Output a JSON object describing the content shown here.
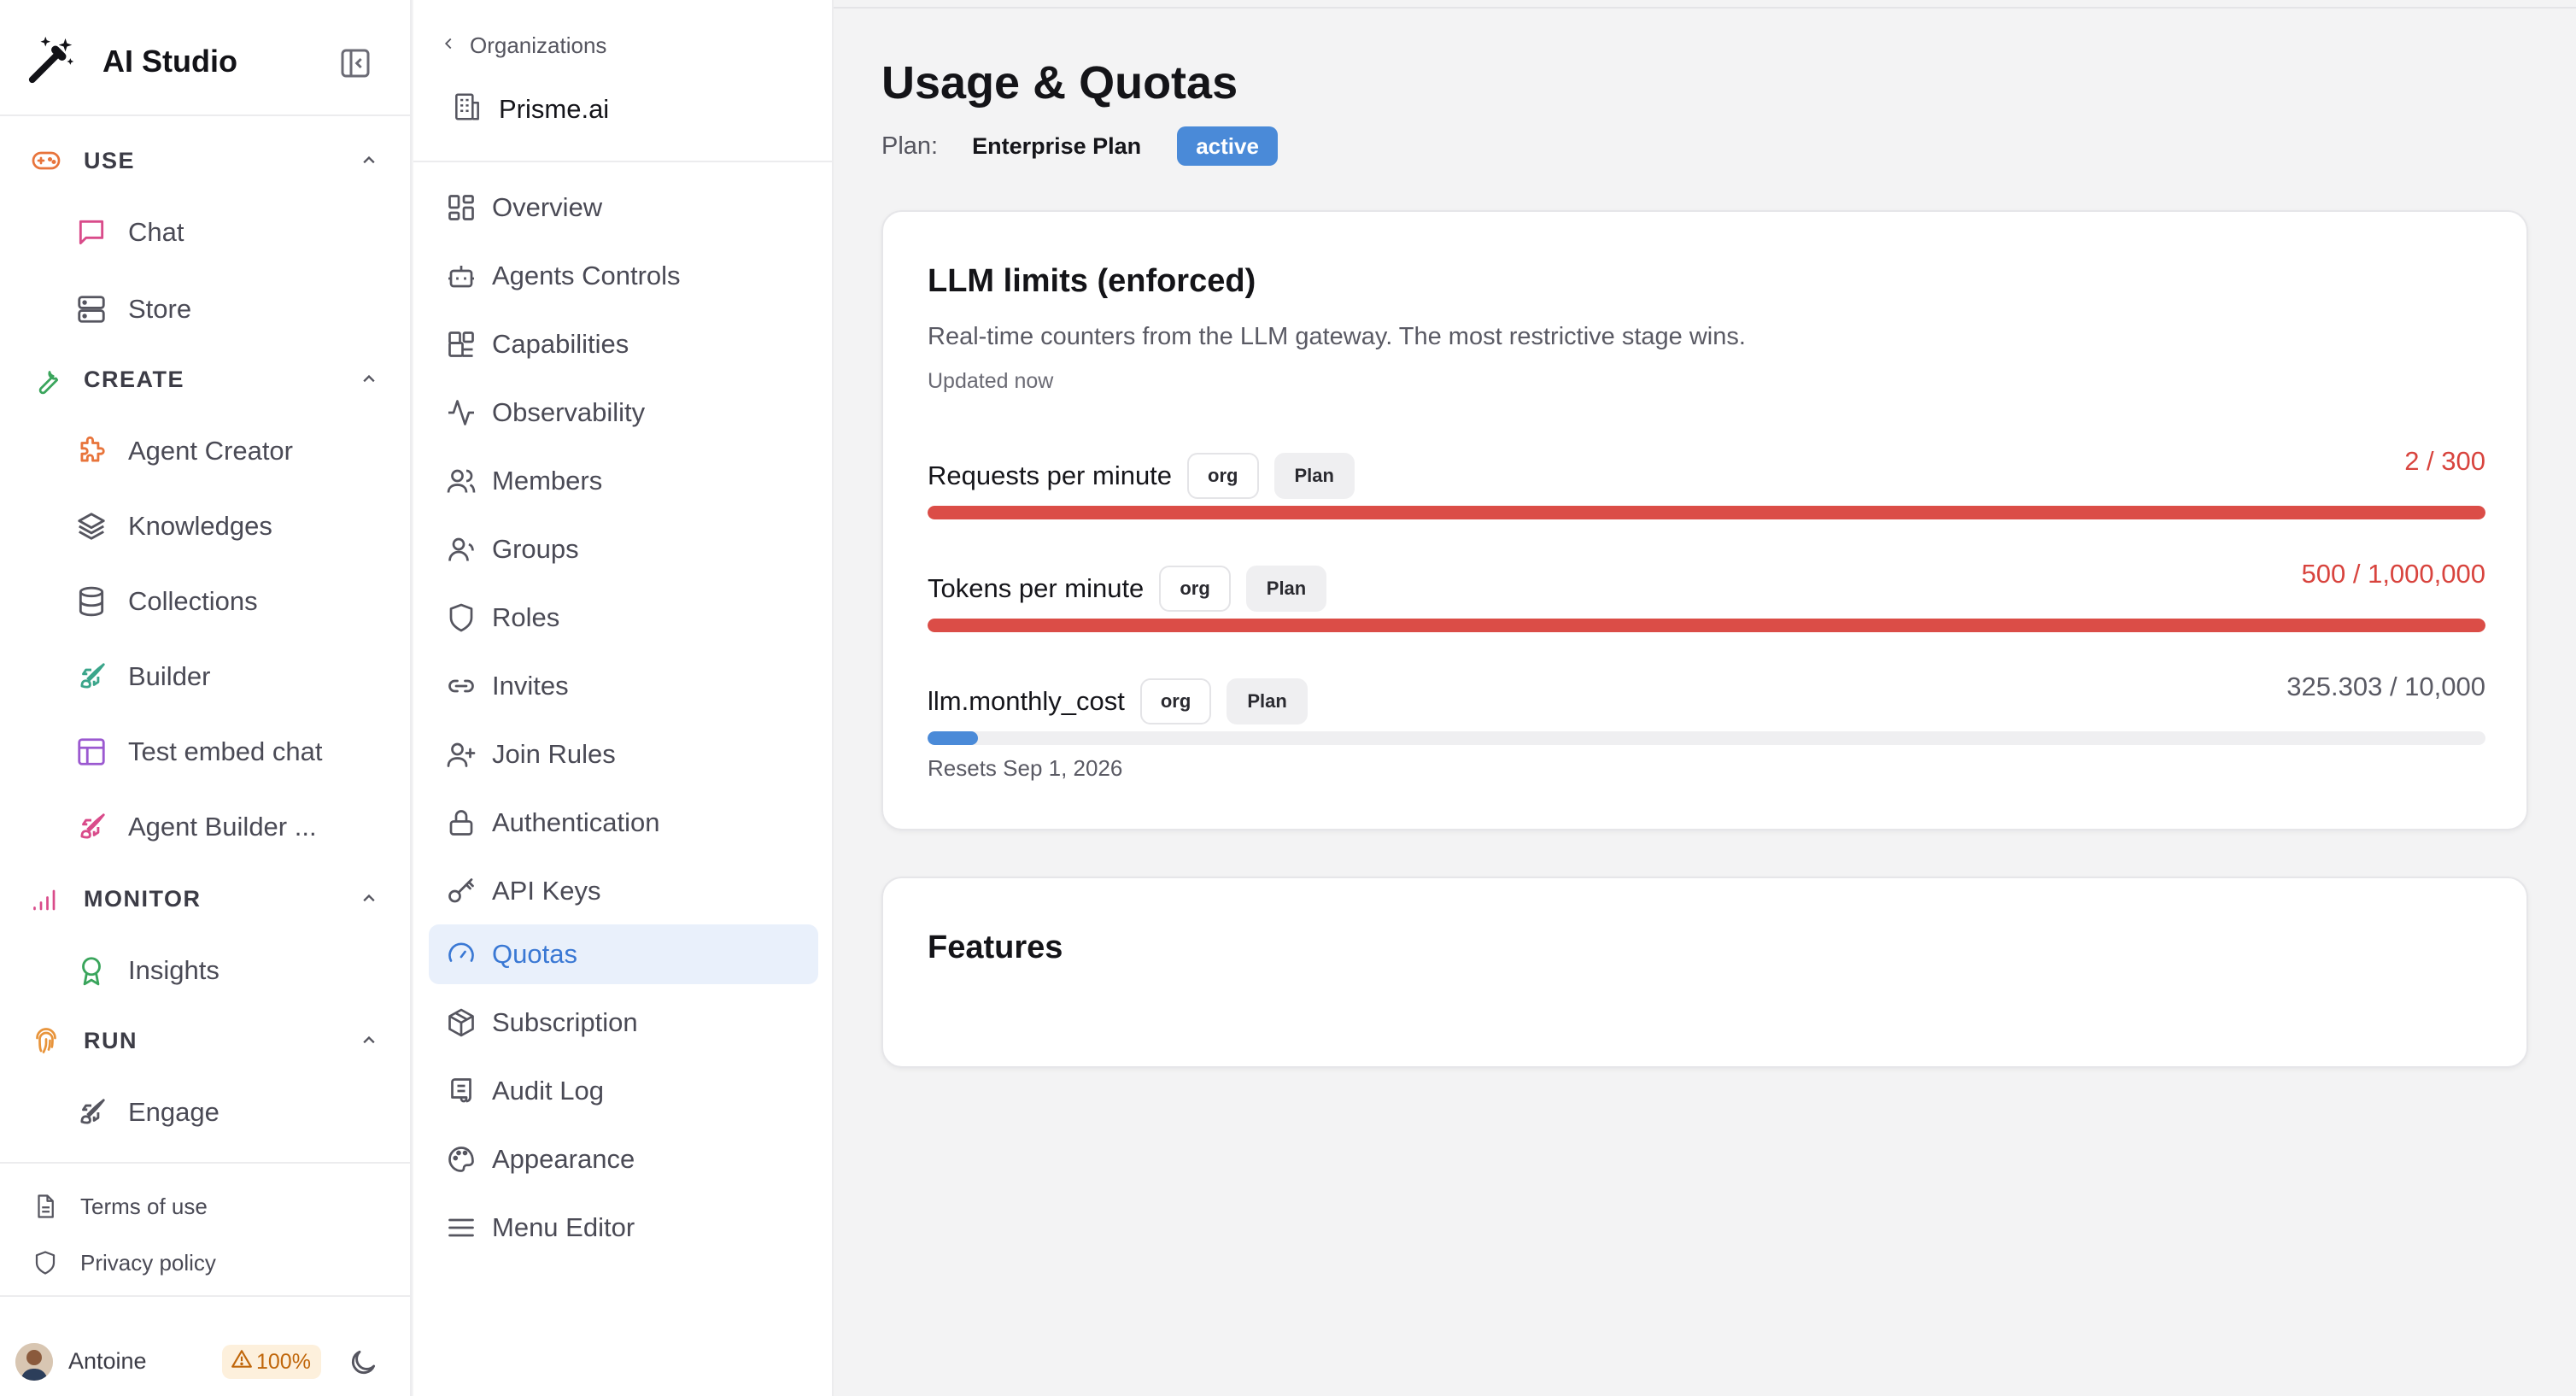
{
  "app": {
    "name": "AI Studio"
  },
  "sidebar": {
    "sections": [
      {
        "key": "use",
        "label": "USE",
        "items": [
          {
            "label": "Chat"
          },
          {
            "label": "Store"
          }
        ]
      },
      {
        "key": "create",
        "label": "CREATE",
        "items": [
          {
            "label": "Agent Creator"
          },
          {
            "label": "Knowledges"
          },
          {
            "label": "Collections"
          },
          {
            "label": "Builder"
          },
          {
            "label": "Test embed chat"
          },
          {
            "label": "Agent Builder ..."
          }
        ]
      },
      {
        "key": "monitor",
        "label": "MONITOR",
        "items": [
          {
            "label": "Insights"
          }
        ]
      },
      {
        "key": "run",
        "label": "RUN",
        "items": [
          {
            "label": "Engage"
          }
        ]
      }
    ],
    "footer_links": [
      {
        "label": "Terms of use"
      },
      {
        "label": "Privacy policy"
      }
    ],
    "user": {
      "name": "Antoine",
      "quota_badge": "100%"
    },
    "icon_colors": {
      "use": "#e8743b",
      "create": "#3aa55c",
      "monitor": "#d94b8a",
      "run": "#e8943b"
    }
  },
  "org_nav": {
    "back_label": "Organizations",
    "org_name": "Prisme.ai",
    "items": [
      {
        "label": "Overview",
        "icon": "grid-icon"
      },
      {
        "label": "Agents Controls",
        "icon": "bot-icon"
      },
      {
        "label": "Capabilities",
        "icon": "blocks-icon"
      },
      {
        "label": "Observability",
        "icon": "activity-icon"
      },
      {
        "label": "Members",
        "icon": "users-icon"
      },
      {
        "label": "Groups",
        "icon": "group-icon"
      },
      {
        "label": "Roles",
        "icon": "shield-icon"
      },
      {
        "label": "Invites",
        "icon": "link-icon"
      },
      {
        "label": "Join Rules",
        "icon": "user-plus-icon"
      },
      {
        "label": "Authentication",
        "icon": "lock-icon"
      },
      {
        "label": "API Keys",
        "icon": "key-icon"
      },
      {
        "label": "Quotas",
        "icon": "gauge-icon",
        "active": true
      },
      {
        "label": "Subscription",
        "icon": "package-icon"
      },
      {
        "label": "Audit Log",
        "icon": "scroll-icon"
      },
      {
        "label": "Appearance",
        "icon": "palette-icon"
      },
      {
        "label": "Menu Editor",
        "icon": "menu-icon"
      }
    ]
  },
  "main": {
    "title": "Usage & Quotas",
    "plan_label": "Plan:",
    "plan_name": "Enterprise Plan",
    "plan_status": "active",
    "llm_card": {
      "title": "LLM limits (enforced)",
      "description": "Real-time counters from the LLM gateway. The most restrictive stage wins.",
      "updated": "Updated now",
      "limits": [
        {
          "name": "Requests per minute",
          "scope": "org",
          "source": "Plan",
          "value_text": "2 / 300",
          "fill_ratio": 1.0,
          "state": "over"
        },
        {
          "name": "Tokens per minute",
          "scope": "org",
          "source": "Plan",
          "value_text": "500 / 1,000,000",
          "fill_ratio": 1.0,
          "state": "over"
        },
        {
          "name": "llm.monthly_cost",
          "scope": "org",
          "source": "Plan",
          "value_text": "325.303 / 10,000",
          "fill_ratio": 0.0325,
          "state": "ok"
        }
      ],
      "resets": "Resets Sep 1, 2026"
    },
    "features_card": {
      "title": "Features"
    }
  },
  "colors": {
    "accent": "#4a8ad8",
    "danger": "#db4d47",
    "active_nav_bg": "#e9f0fb"
  }
}
